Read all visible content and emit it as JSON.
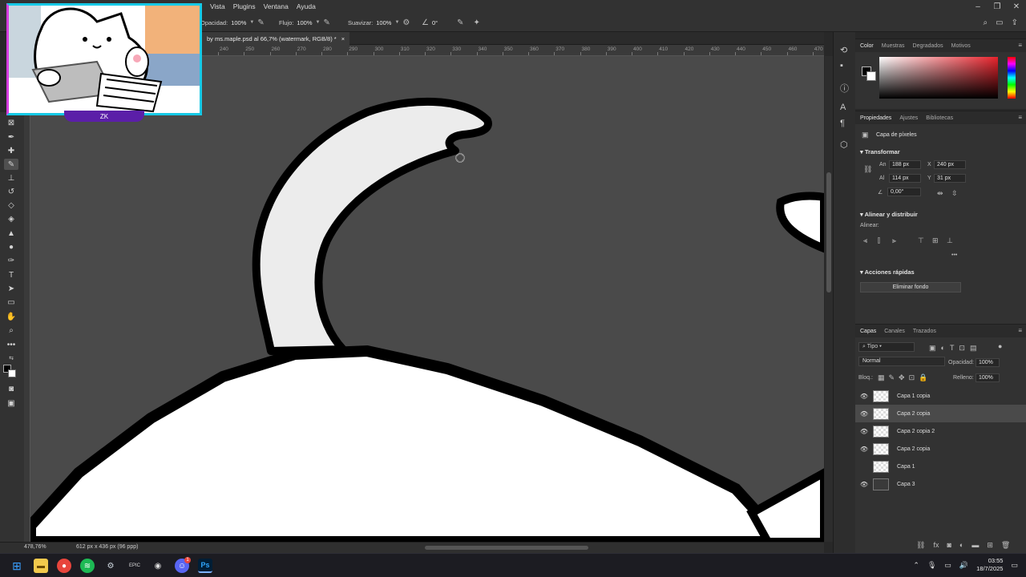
{
  "menubar": {
    "items": [
      "Vista",
      "Plugins",
      "Ventana",
      "Ayuda"
    ]
  },
  "options": {
    "opacity_label": "Opacidad:",
    "opacity_value": "100%",
    "flow_label": "Flujo:",
    "flow_value": "100%",
    "smooth_label": "Suavizar:",
    "smooth_value": "100%",
    "angle_value": "0°"
  },
  "document": {
    "tab_title": "by ms.maple.psd al 66,7% (watermark, RGB/8) *",
    "close": "×"
  },
  "ruler": {
    "ticks": [
      "240",
      "250",
      "260",
      "270",
      "280",
      "290",
      "300",
      "310",
      "320",
      "330",
      "340",
      "350",
      "360",
      "370",
      "380",
      "390",
      "400",
      "410",
      "420",
      "430",
      "440",
      "450",
      "460",
      "470"
    ]
  },
  "webcam_badge": "ZK",
  "status": {
    "zoom": "478,76%",
    "dimensions": "612 px x 436 px (96 ppp)"
  },
  "color_panel": {
    "tabs": [
      "Color",
      "Muestras",
      "Degradados",
      "Motivos"
    ]
  },
  "properties_panel": {
    "tabs": [
      "Propiedades",
      "Ajustes",
      "Bibliotecas"
    ],
    "layer_type": "Capa de píxeles",
    "transform_title": "Transformar",
    "w_label": "An",
    "w_value": "188 px",
    "x_label": "X",
    "x_value": "240 px",
    "h_label": "Al",
    "h_value": "114 px",
    "y_label": "Y",
    "y_value": "31 px",
    "angle_value": "0,00°",
    "align_title": "Alinear y distribuir",
    "align_label": "Alinear:",
    "more": "•••",
    "quick_title": "Acciones rápidas",
    "remove_bg": "Eliminar fondo"
  },
  "layers_panel": {
    "tabs": [
      "Capas",
      "Canales",
      "Trazados"
    ],
    "filter": "Tipo",
    "blend_mode": "Normal",
    "opacity_label": "Opacidad:",
    "opacity_value": "100%",
    "lock_label": "Bloq.:",
    "fill_label": "Relleno:",
    "fill_value": "100%",
    "layers": [
      {
        "name": "Capa 1 copia",
        "visible": true
      },
      {
        "name": "Capa 2 copia",
        "visible": true,
        "selected": true
      },
      {
        "name": "Capa 2 copia 2",
        "visible": true
      },
      {
        "name": "Capa 2 copia",
        "visible": true
      },
      {
        "name": "Capa 1",
        "visible": false
      },
      {
        "name": "Capa 3",
        "visible": true
      }
    ]
  },
  "taskbar": {
    "time": "03:55",
    "date": "18/7/2025",
    "discord_badge": "1"
  },
  "colors": {
    "accent_cyan": "#16c9e6",
    "accent_magenta": "#d63de0",
    "badge_purple": "#5b1fa8"
  }
}
